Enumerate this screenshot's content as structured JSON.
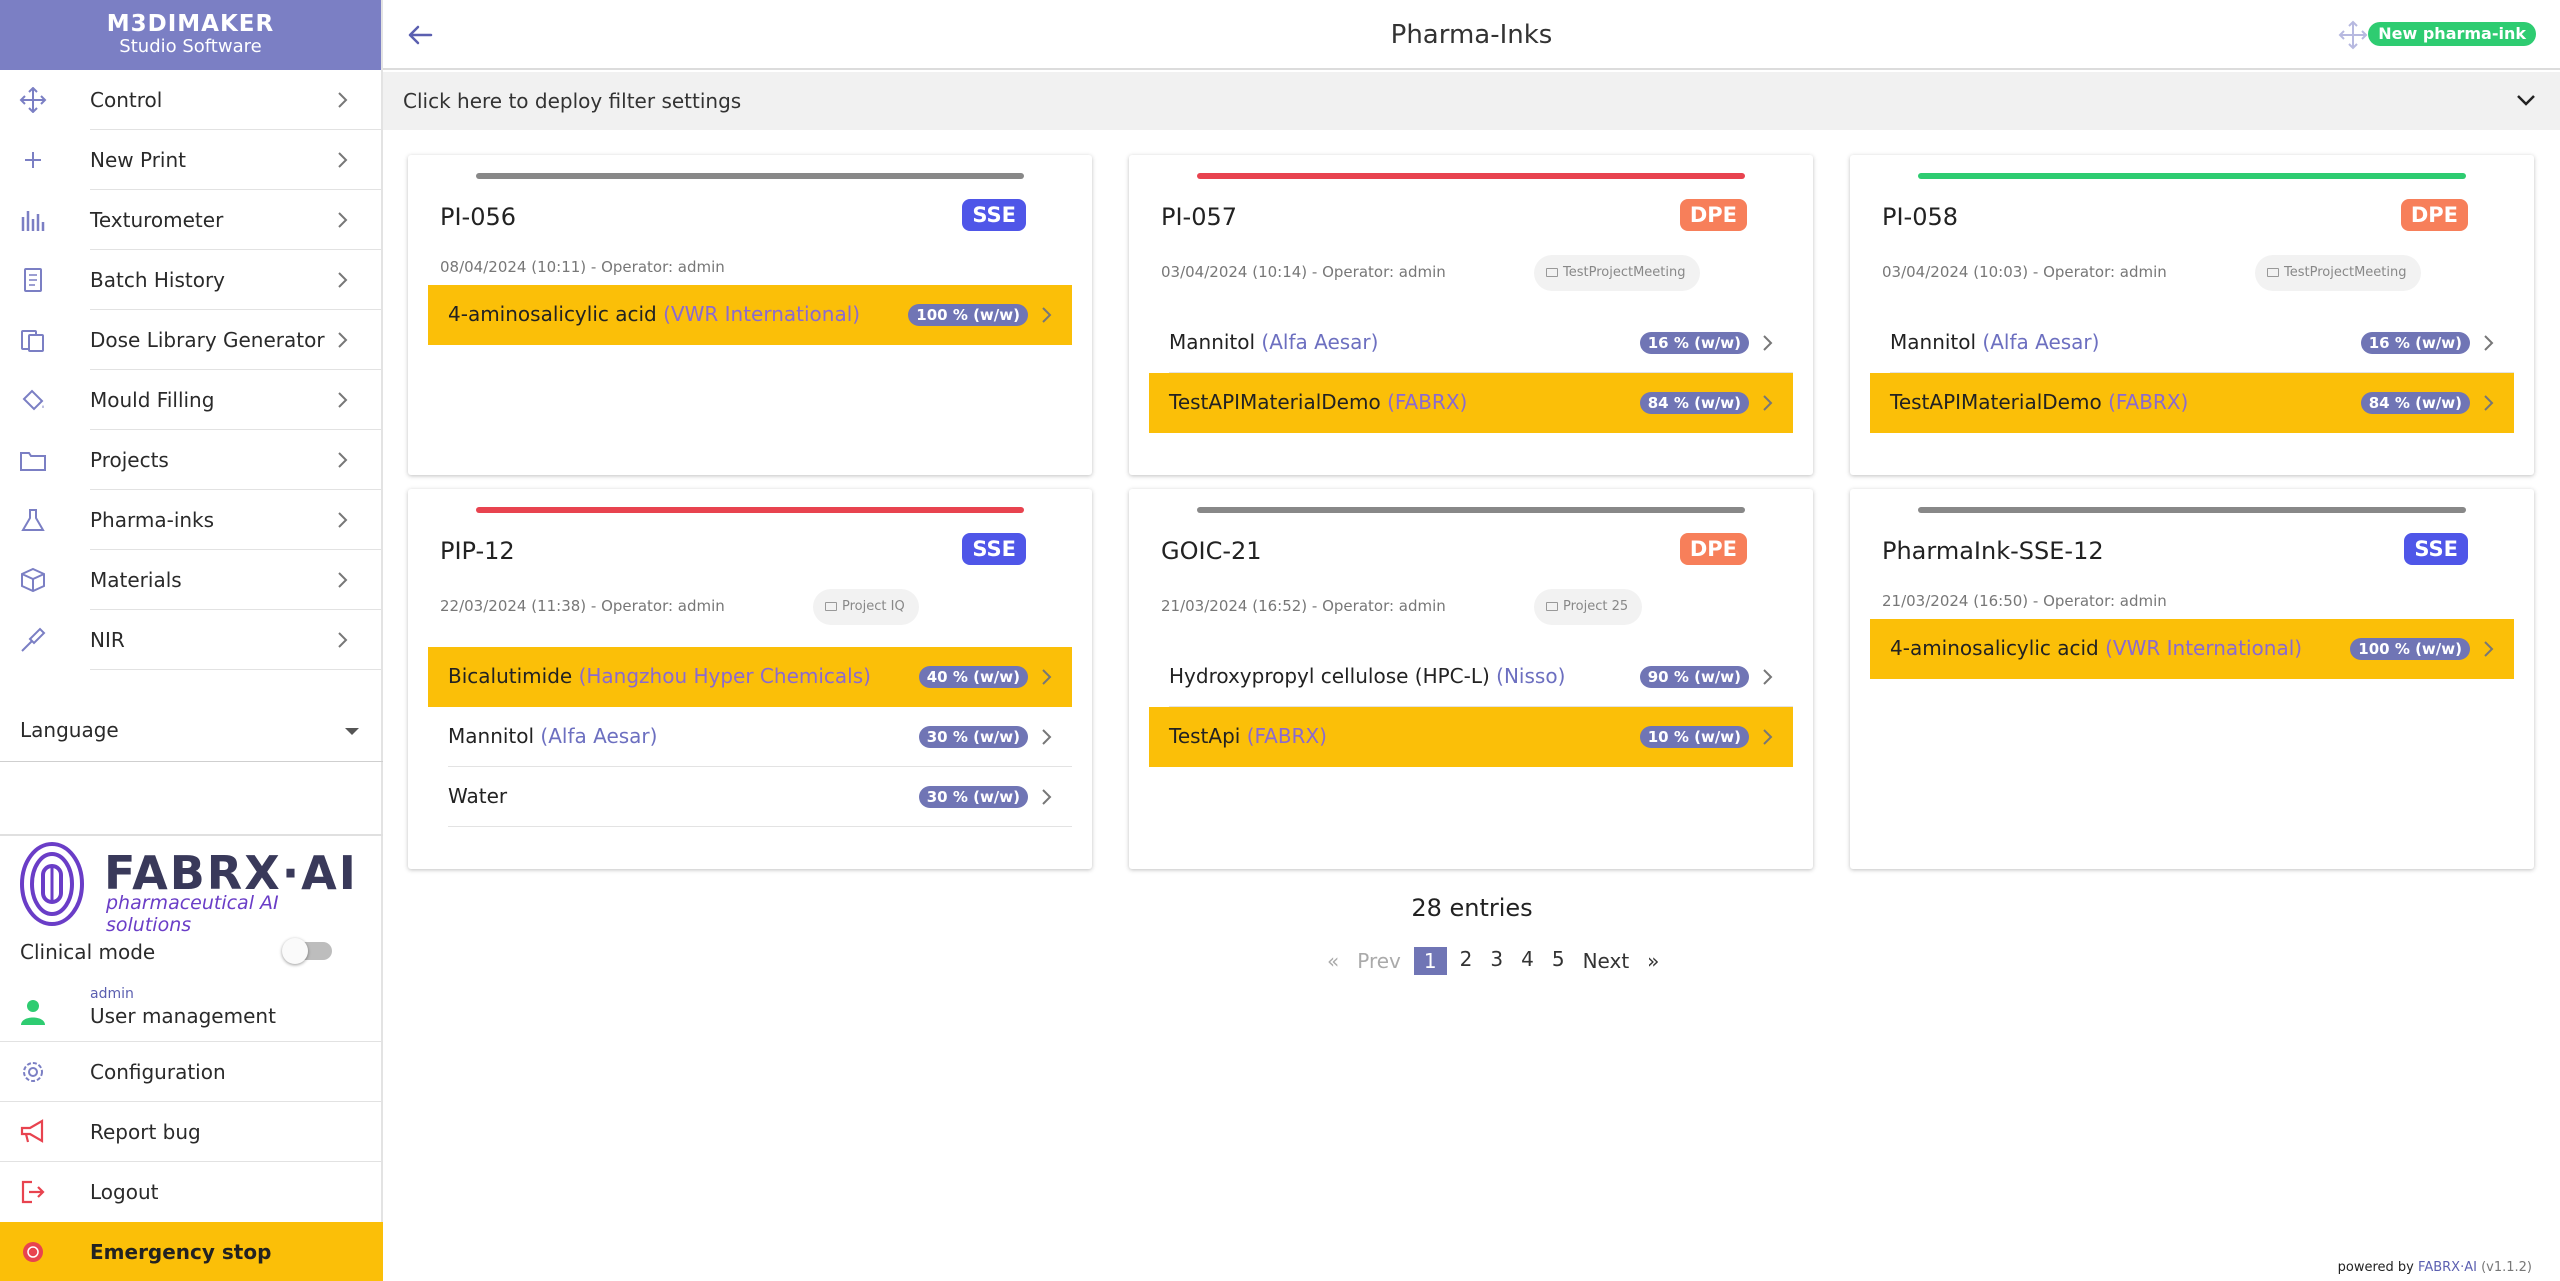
{
  "brand": {
    "line1": "M3DIMAKER",
    "line2": "Studio Software"
  },
  "sidebar": {
    "items": [
      {
        "label": "Control",
        "icon": "move-icon"
      },
      {
        "label": "New Print",
        "icon": "plus-icon"
      },
      {
        "label": "Texturometer",
        "icon": "bar-chart-icon"
      },
      {
        "label": "Batch History",
        "icon": "document-icon"
      },
      {
        "label": "Dose Library Generator",
        "icon": "copy-icon"
      },
      {
        "label": "Mould Filling",
        "icon": "paint-bucket-icon"
      },
      {
        "label": "Projects",
        "icon": "folder-icon"
      },
      {
        "label": "Pharma-inks",
        "icon": "flask-icon"
      },
      {
        "label": "Materials",
        "icon": "box-icon"
      },
      {
        "label": "NIR",
        "icon": "probe-icon"
      }
    ],
    "language_label": "Language",
    "logo": {
      "word": "FABRX·AI",
      "tagline": "pharmaceutical AI solutions"
    },
    "clinical_mode_label": "Clinical mode",
    "clinical_mode_on": false,
    "user_name": "admin",
    "user_management_label": "User management",
    "configuration_label": "Configuration",
    "report_bug_label": "Report bug",
    "logout_label": "Logout",
    "emergency_label": "Emergency stop"
  },
  "header": {
    "title": "Pharma-Inks",
    "new_button": "New pharma-ink"
  },
  "filter": {
    "label": "Click here to deploy filter settings"
  },
  "colors": {
    "accent": "#7b7fc4",
    "sse": "#4f56e8",
    "dpe": "#f77f5a",
    "highlight": "#fbbf08",
    "bar_gray": "#888888",
    "bar_red": "#e8434f",
    "bar_green": "#2ecc71"
  },
  "cards": [
    {
      "name": "PI-056",
      "type": "SSE",
      "bar": "gray",
      "meta": "08/04/2024 (10:11) - Operator: admin",
      "project": "",
      "rows": [
        {
          "name": "4-aminosalicylic acid",
          "supplier": "(VWR International)",
          "pct": "100 % (w/w)",
          "hl": true
        }
      ]
    },
    {
      "name": "PI-057",
      "type": "DPE",
      "bar": "red",
      "meta": "03/04/2024 (10:14) - Operator: admin",
      "project": "TestProjectMeeting",
      "rows": [
        {
          "name": "Mannitol",
          "supplier": "(Alfa Aesar)",
          "pct": "16 % (w/w)",
          "hl": false
        },
        {
          "name": "TestAPIMaterialDemo",
          "supplier": "(FABRX)",
          "pct": "84 % (w/w)",
          "hl": true
        }
      ]
    },
    {
      "name": "PI-058",
      "type": "DPE",
      "bar": "green",
      "meta": "03/04/2024 (10:03) - Operator: admin",
      "project": "TestProjectMeeting",
      "rows": [
        {
          "name": "Mannitol",
          "supplier": "(Alfa Aesar)",
          "pct": "16 % (w/w)",
          "hl": false
        },
        {
          "name": "TestAPIMaterialDemo",
          "supplier": "(FABRX)",
          "pct": "84 % (w/w)",
          "hl": true
        }
      ]
    },
    {
      "name": "PIP-12",
      "type": "SSE",
      "bar": "red",
      "meta": "22/03/2024 (11:38) - Operator: admin",
      "project": "Project IQ",
      "rows": [
        {
          "name": "Bicalutimide",
          "supplier": "(Hangzhou Hyper Chemicals)",
          "pct": "40 % (w/w)",
          "hl": true
        },
        {
          "name": "Mannitol",
          "supplier": "(Alfa Aesar)",
          "pct": "30 % (w/w)",
          "hl": false
        },
        {
          "name": "Water",
          "supplier": "",
          "pct": "30 % (w/w)",
          "hl": false
        }
      ]
    },
    {
      "name": "GOIC-21",
      "type": "DPE",
      "bar": "gray",
      "meta": "21/03/2024 (16:52) - Operator: admin",
      "project": "Project 25",
      "rows": [
        {
          "name": "Hydroxypropyl cellulose (HPC-L)",
          "supplier": "(Nisso)",
          "pct": "90 % (w/w)",
          "hl": false
        },
        {
          "name": "TestApi",
          "supplier": "(FABRX)",
          "pct": "10 % (w/w)",
          "hl": true
        }
      ]
    },
    {
      "name": "PharmaInk-SSE-12",
      "type": "SSE",
      "bar": "gray",
      "meta": "21/03/2024 (16:50) - Operator: admin",
      "project": "",
      "rows": [
        {
          "name": "4-aminosalicylic acid",
          "supplier": "(VWR International)",
          "pct": "100 % (w/w)",
          "hl": true
        }
      ]
    }
  ],
  "pagination": {
    "entries": "28 entries",
    "first": "«",
    "prev": "Prev",
    "pages": [
      "1",
      "2",
      "3",
      "4",
      "5"
    ],
    "current": "1",
    "next": "Next",
    "last": "»"
  },
  "footer": {
    "powered": "powered by",
    "brand": "FABRX·AI",
    "version": "(v1.1.2)"
  }
}
